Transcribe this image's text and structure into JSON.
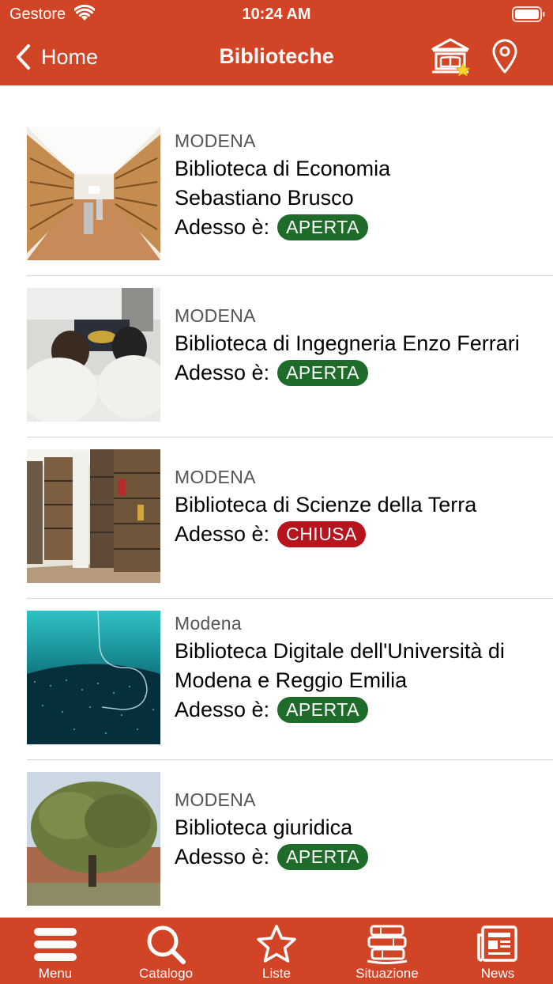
{
  "status_bar": {
    "carrier": "Gestore",
    "time": "10:24 AM"
  },
  "nav": {
    "back_label": "Home",
    "title": "Biblioteche"
  },
  "colors": {
    "brand": "#d24426",
    "open": "#1e6b2a",
    "closed": "#b8141e"
  },
  "libraries": [
    {
      "city": "MODENA",
      "name": "Biblioteca di Economia Sebastiano Brusco",
      "now_label": "Adesso è:",
      "status": "APERTA",
      "open": true
    },
    {
      "city": "MODENA",
      "name": "Biblioteca di Ingegneria Enzo Ferrari",
      "now_label": "Adesso è:",
      "status": "APERTA",
      "open": true
    },
    {
      "city": "MODENA",
      "name": "Biblioteca di Scienze della Terra",
      "now_label": "Adesso è:",
      "status": "CHIUSA",
      "open": false
    },
    {
      "city": "Modena",
      "name": "Biblioteca Digitale dell'Università di Modena e Reggio Emilia",
      "now_label": "Adesso è:",
      "status": "APERTA",
      "open": true
    },
    {
      "city": "MODENA",
      "name": "Biblioteca giuridica",
      "now_label": "Adesso è:",
      "status": "APERTA",
      "open": true
    }
  ],
  "tabbar": {
    "items": [
      {
        "label": "Menu",
        "icon": "menu-icon"
      },
      {
        "label": "Catalogo",
        "icon": "search-icon"
      },
      {
        "label": "Liste",
        "icon": "star-icon"
      },
      {
        "label": "Situazione",
        "icon": "books-icon"
      },
      {
        "label": "News",
        "icon": "newspaper-icon"
      }
    ]
  }
}
